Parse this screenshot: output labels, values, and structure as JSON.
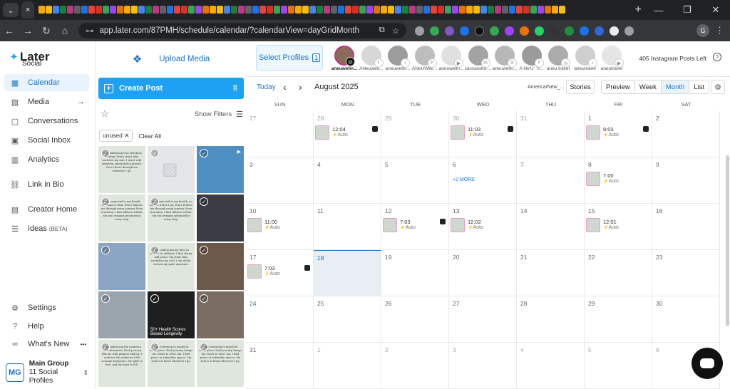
{
  "browser": {
    "tab_label": "×",
    "url": "app.later.com/87PMH/schedule/calendar/?calendarView=dayGridMonth",
    "new_tab": "+",
    "profile_initial": "G"
  },
  "app": {
    "logo": "Later",
    "logo_sub": "Social"
  },
  "sidebar": {
    "items": [
      {
        "label": "Calendar",
        "icon": "calendar-icon"
      },
      {
        "label": "Media",
        "icon": "image-icon"
      },
      {
        "label": "Conversations",
        "icon": "chat-icon"
      },
      {
        "label": "Social Inbox",
        "icon": "inbox-icon"
      },
      {
        "label": "Analytics",
        "icon": "chart-icon"
      },
      {
        "label": "Link in Bio",
        "icon": "link-icon"
      },
      {
        "label": "Creator Home",
        "icon": "home-icon"
      },
      {
        "label": "Ideas",
        "icon": "ideas-icon",
        "badge": "(BETA)"
      }
    ],
    "bottom": [
      {
        "label": "Settings",
        "icon": "gear-icon"
      },
      {
        "label": "Help",
        "icon": "help-icon"
      },
      {
        "label": "What's New",
        "icon": "whats-new-icon"
      }
    ],
    "account": {
      "initials": "MG",
      "name": "Main Group",
      "profiles": "11 Social Profiles"
    }
  },
  "media": {
    "upload_label": "Upload Media",
    "create_label": "Create Post",
    "show_filters": "Show Filters",
    "chip": "unused",
    "clear_all": "Clear All"
  },
  "profiles": {
    "select_label": "Select Profiles",
    "select_count": "1",
    "list": [
      {
        "name": "aneuwelln...",
        "net": "instagram"
      },
      {
        "name": "ANeuwell...",
        "net": "facebook"
      },
      {
        "name": "aneuwelln...",
        "net": "tiktok"
      },
      {
        "name": "ANeUWell...",
        "net": "pinterest"
      },
      {
        "name": "aneuwelln...",
        "net": "youtube"
      },
      {
        "name": "cassandra-...",
        "net": "linkedin"
      },
      {
        "name": "aneuwelln...",
        "net": "twitter"
      },
      {
        "name": "A Ne'U' Tr...",
        "net": "facebook"
      },
      {
        "name": "aneu.travel",
        "net": "instagram"
      },
      {
        "name": "aneutravel",
        "net": "tiktok"
      },
      {
        "name": "aneutravel",
        "net": "youtube"
      }
    ],
    "posts_left": "405 Instagram Posts Left"
  },
  "toolbar": {
    "today": "Today",
    "month_label": "August 2025",
    "timezone": "America/New_...",
    "stories": "Stories",
    "preview": "Preview",
    "views": [
      "Week",
      "Month",
      "List"
    ],
    "active_view": "Month"
  },
  "weekdays": [
    "SUN",
    "MON",
    "TUE",
    "WED",
    "THU",
    "FRI",
    "SAT"
  ],
  "weeks": [
    [
      {
        "d": "27",
        "o": true
      },
      {
        "d": "28",
        "o": true
      },
      {
        "d": "29",
        "o": true
      },
      {
        "d": "30",
        "o": true
      },
      {
        "d": "31",
        "o": true
      },
      {
        "d": "1"
      },
      {
        "d": "2"
      }
    ],
    [
      {
        "d": "3"
      },
      {
        "d": "4"
      },
      {
        "d": "5"
      },
      {
        "d": "6"
      },
      {
        "d": "7"
      },
      {
        "d": "8"
      },
      {
        "d": "9"
      }
    ],
    [
      {
        "d": "10"
      },
      {
        "d": "11"
      },
      {
        "d": "12"
      },
      {
        "d": "13"
      },
      {
        "d": "14"
      },
      {
        "d": "15"
      },
      {
        "d": "16"
      }
    ],
    [
      {
        "d": "17"
      },
      {
        "d": "18",
        "today": true
      },
      {
        "d": "19"
      },
      {
        "d": "20"
      },
      {
        "d": "21"
      },
      {
        "d": "22"
      },
      {
        "d": "23"
      }
    ],
    [
      {
        "d": "24"
      },
      {
        "d": "25"
      },
      {
        "d": "26"
      },
      {
        "d": "27"
      },
      {
        "d": "28"
      },
      {
        "d": "29"
      },
      {
        "d": "30"
      }
    ],
    [
      {
        "d": "31"
      },
      {
        "d": "1",
        "o": true
      },
      {
        "d": "2",
        "o": true
      },
      {
        "d": "3",
        "o": true
      },
      {
        "d": "4",
        "o": true
      },
      {
        "d": "5",
        "o": true
      },
      {
        "d": "6",
        "o": true
      }
    ]
  ],
  "posts": [
    {
      "week": 0,
      "day": 1,
      "time": "12:04",
      "auto": "Auto",
      "reel": true
    },
    {
      "week": 0,
      "day": 3,
      "time": "11:03",
      "auto": "Auto",
      "reel": true
    },
    {
      "week": 0,
      "day": 5,
      "time": "8:03",
      "auto": "Auto",
      "reel": true
    },
    {
      "week": 1,
      "day": 5,
      "time": "7:00",
      "auto": "Auto",
      "reel": false
    },
    {
      "week": 2,
      "day": 0,
      "time": "11:00",
      "auto": "Auto",
      "reel": false
    },
    {
      "week": 2,
      "day": 2,
      "time": "7:03",
      "auto": "Auto",
      "reel": true
    },
    {
      "week": 2,
      "day": 3,
      "time": "12:02",
      "auto": "Auto",
      "reel": false
    },
    {
      "week": 2,
      "day": 5,
      "time": "12:01",
      "auto": "Auto",
      "reel": false
    },
    {
      "week": 3,
      "day": 0,
      "time": "7:03",
      "auto": "Auto",
      "reel": true
    }
  ],
  "more_link": {
    "week": 1,
    "day": 3,
    "label": "+2 MORE"
  },
  "media_tiles": [
    {
      "text": "I am embracing true and deep healing. Every step I take nurtures my soul. I move with intention, grounded in growth. Peace flows through me wherever I go.",
      "bg": "#dfe6dd"
    },
    {
      "text": "",
      "bg": "#e4e7ea"
    },
    {
      "text": "",
      "bg": "#4f8fc2",
      "cap": ""
    },
    {
      "text": "I am connected to my breath. My mind is clear. Peace follows me through every journey. Even in motion, I find stillness within. My soul remains grounded in every step.",
      "bg": "#dfe6dd"
    },
    {
      "text": "I am connected to my breath, no matter where I go. Peace follows me through every journey. Even in motion, I find stillness within. My soul remains grounded in every step.",
      "bg": "#dfe6dd"
    },
    {
      "text": "",
      "bg": "#3b3b44"
    },
    {
      "text": "",
      "bg": "#8aa6c2"
    },
    {
      "text": "I am embracing my time as sacred. In stillness, I find clarity and peace. My alone time nourishes my soul. I am whole, even in my quiet moments.",
      "bg": "#dfe6dd"
    },
    {
      "text": "",
      "bg": "#6b5a4c"
    },
    {
      "text": "",
      "bg": "#9aa4ad"
    },
    {
      "text": "",
      "bg": "#1f1f1f",
      "cap": "50+ Health Scores Based Longevity"
    },
    {
      "text": "",
      "bg": "#7b6d62"
    },
    {
      "text": "I am embracing the unknown with adventure. Each journey fills me with purpose and joy. I embrace the unknown with courage and peace. My spirit is free, and my heart is full.",
      "bg": "#dfe6dd"
    },
    {
      "text": "I am returning to myself in every place. Each journey brings me closer to who I am. I find peace in unfamiliar spaces. My soul is at home wherever I go.",
      "bg": "#dfe6dd"
    },
    {
      "text": "I am returning to myself in every place. Each journey brings me closer to who I am. I find peace in unfamiliar spaces. My soul is at home wherever I go.",
      "bg": "#dfe6dd"
    }
  ]
}
